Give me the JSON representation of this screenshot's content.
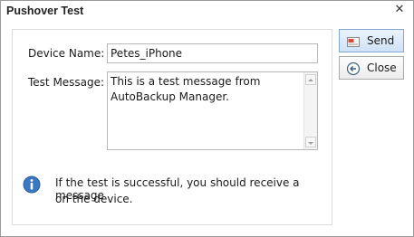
{
  "window": {
    "title": "Pushover Test"
  },
  "form": {
    "device_name_label": "Device Name:",
    "device_name_value": "Petes_iPhone",
    "test_message_label": "Test Message:",
    "test_message_value": "This is a test message from\nAutoBackup Manager."
  },
  "info": {
    "text_line1": "If the test is successful, you should receive a message",
    "text_line2": "on the device."
  },
  "buttons": {
    "send_label": "Send",
    "close_label": "Close"
  },
  "icons": {
    "info": "info-icon",
    "send": "send-icon",
    "close": "back-arrow-icon",
    "window_close": "close-icon"
  },
  "colors": {
    "primary_button": "#cfe2f6",
    "info_icon": "#3a78c2"
  }
}
